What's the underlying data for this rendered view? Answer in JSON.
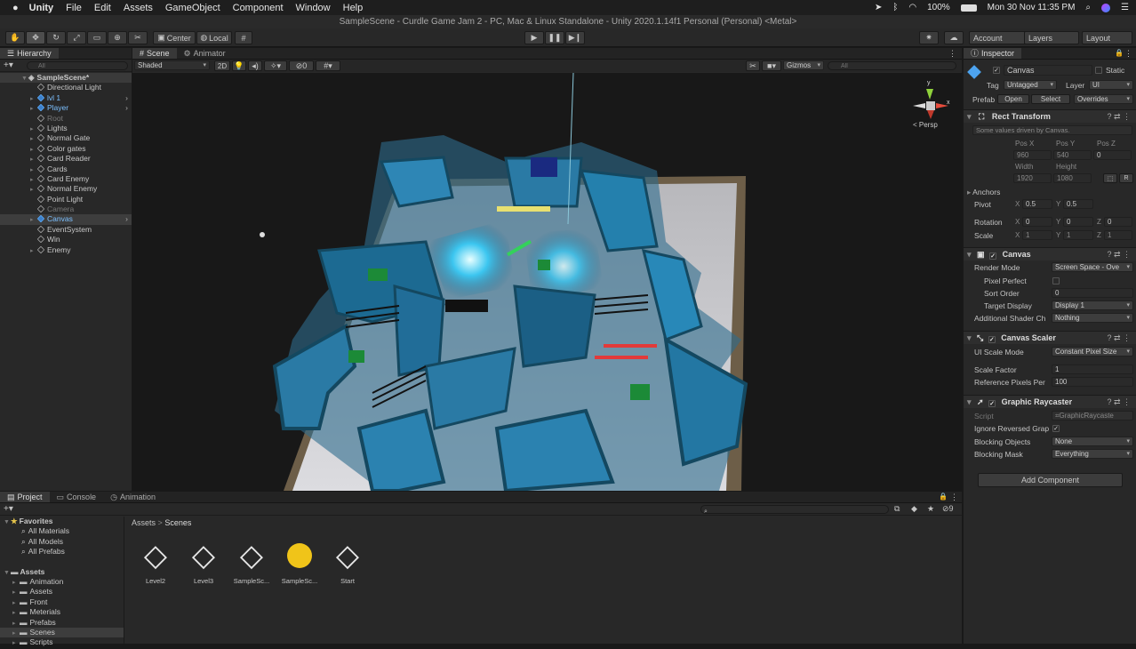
{
  "macbar": {
    "menus": [
      "Unity",
      "File",
      "Edit",
      "Assets",
      "GameObject",
      "Component",
      "Window",
      "Help"
    ],
    "battery": "100%",
    "datetime": "Mon 30 Nov  11:35 PM"
  },
  "title": "SampleScene - Curdle Game Jam 2 - PC, Mac & Linux Standalone - Unity 2020.1.14f1 Personal (Personal) <Metal>",
  "toolbar": {
    "pivot": "Center",
    "space": "Local",
    "account": "Account",
    "layers": "Layers",
    "layout": "Layout"
  },
  "hierarchy": {
    "tab": "Hierarchy",
    "search_placeholder": "All",
    "scene": "SampleScene*",
    "items": [
      {
        "label": "Directional Light",
        "arrow": false,
        "blue": false,
        "dim": false
      },
      {
        "label": "lvl 1",
        "arrow": true,
        "blue": true,
        "dim": false
      },
      {
        "label": "Player",
        "arrow": true,
        "blue": true,
        "dim": false
      },
      {
        "label": "Root",
        "arrow": false,
        "blue": false,
        "dim": true
      },
      {
        "label": "Lights",
        "arrow": true,
        "blue": false,
        "dim": false
      },
      {
        "label": "Normal Gate",
        "arrow": true,
        "blue": false,
        "dim": false
      },
      {
        "label": "Color gates",
        "arrow": true,
        "blue": false,
        "dim": false
      },
      {
        "label": "Card Reader",
        "arrow": true,
        "blue": false,
        "dim": false
      },
      {
        "label": "Cards",
        "arrow": true,
        "blue": false,
        "dim": false
      },
      {
        "label": "Card Enemy",
        "arrow": true,
        "blue": false,
        "dim": false
      },
      {
        "label": "Normal Enemy",
        "arrow": true,
        "blue": false,
        "dim": false
      },
      {
        "label": "Point Light",
        "arrow": false,
        "blue": false,
        "dim": false
      },
      {
        "label": "Camera",
        "arrow": false,
        "blue": false,
        "dim": true
      },
      {
        "label": "Canvas",
        "arrow": true,
        "blue": true,
        "dim": false,
        "selected": true
      },
      {
        "label": "EventSystem",
        "arrow": false,
        "blue": false,
        "dim": false
      },
      {
        "label": "Win",
        "arrow": false,
        "blue": false,
        "dim": false
      },
      {
        "label": "Enemy",
        "arrow": true,
        "blue": false,
        "dim": false
      }
    ]
  },
  "scene": {
    "tabs": [
      "Scene",
      "Animator"
    ],
    "shading": "Shaded",
    "mode_2d": "2D",
    "gizmos": "Gizmos",
    "search_placeholder": "All",
    "persp": "< Persp",
    "axis_y": "y",
    "axis_x": "x"
  },
  "inspector": {
    "tab": "Inspector",
    "object_name": "Canvas",
    "static_label": "Static",
    "tag_label": "Tag",
    "tag_value": "Untagged",
    "layer_label": "Layer",
    "layer_value": "UI",
    "prefab_label": "Prefab",
    "prefab_open": "Open",
    "prefab_select": "Select",
    "prefab_overrides": "Overrides",
    "rect_transform": {
      "title": "Rect Transform",
      "note": "Some values driven by Canvas.",
      "posx_label": "Pos X",
      "posx": "960",
      "posy_label": "Pos Y",
      "posy": "540",
      "posz_label": "Pos Z",
      "posz": "0",
      "width_label": "Width",
      "width": "1920",
      "height_label": "Height",
      "height": "1080",
      "anchors": "Anchors",
      "pivot_label": "Pivot",
      "pivot_x": "0.5",
      "pivot_y": "0.5",
      "rotation_label": "Rotation",
      "rot_x": "0",
      "rot_y": "0",
      "rot_z": "0",
      "scale_label": "Scale",
      "scale_x": "1",
      "scale_y": "1",
      "scale_z": "1",
      "x": "X",
      "y": "Y",
      "z": "Z"
    },
    "canvas": {
      "title": "Canvas",
      "render_mode_label": "Render Mode",
      "render_mode": "Screen Space - Ove",
      "pixel_perfect_label": "Pixel Perfect",
      "sort_order_label": "Sort Order",
      "sort_order": "0",
      "target_display_label": "Target Display",
      "target_display": "Display 1",
      "additional_label": "Additional Shader Ch",
      "additional": "Nothing"
    },
    "scaler": {
      "title": "Canvas Scaler",
      "ui_scale_label": "UI Scale Mode",
      "ui_scale": "Constant Pixel Size",
      "scale_factor_label": "Scale Factor",
      "scale_factor": "1",
      "ref_ppu_label": "Reference Pixels Per",
      "ref_ppu": "100"
    },
    "raycaster": {
      "title": "Graphic Raycaster",
      "script_label": "Script",
      "script": "GraphicRaycaste",
      "ignore_label": "Ignore Reversed Grap",
      "blocking_objects_label": "Blocking Objects",
      "blocking_objects": "None",
      "blocking_mask_label": "Blocking Mask",
      "blocking_mask": "Everything"
    },
    "add_component": "Add Component"
  },
  "project": {
    "tabs": [
      "Project",
      "Console",
      "Animation"
    ],
    "favorites": "Favorites",
    "fav_items": [
      "All Materials",
      "All Models",
      "All Prefabs"
    ],
    "assets": "Assets",
    "asset_folders": [
      "Animation",
      "Assets",
      "Front",
      "Meterials",
      "Prefabs",
      "Scenes",
      "Scripts"
    ],
    "breadcrumb_root": "Assets",
    "breadcrumb_sep": ">",
    "breadcrumb_leaf": "Scenes",
    "badge_count": "9",
    "files": [
      "Level2",
      "Level3",
      "SampleSc...",
      "SampleSc...",
      "Start"
    ]
  },
  "colors": {
    "wall": "#1f6f9a",
    "wall_light": "#2a8fbf",
    "floor": "#c8c8cc",
    "accent_blue": "#3c7fc9"
  }
}
